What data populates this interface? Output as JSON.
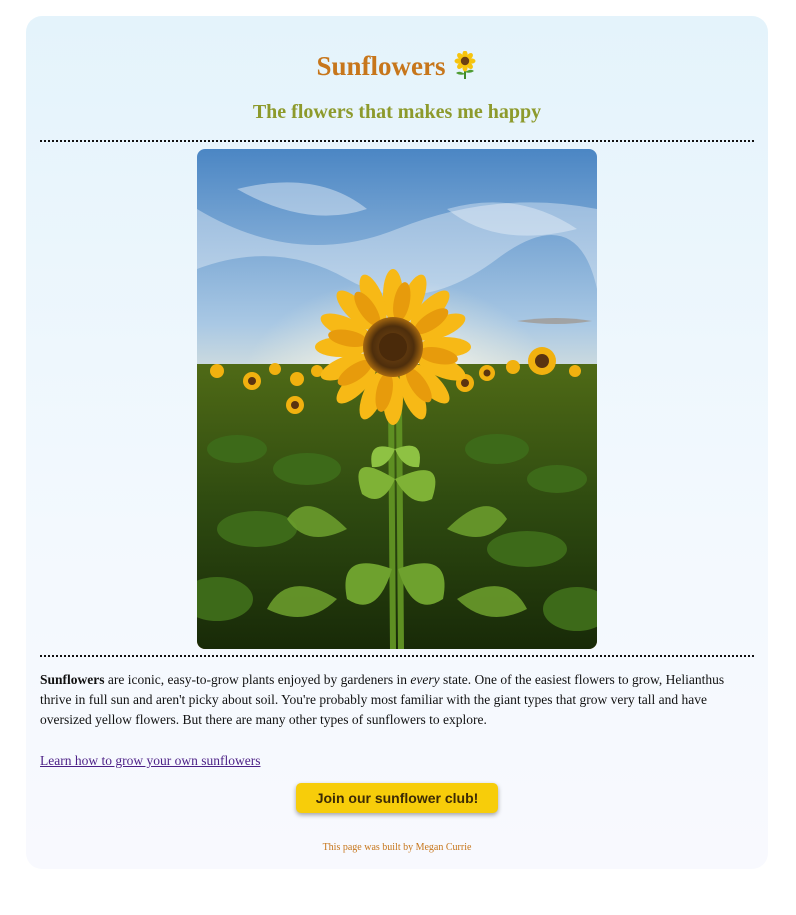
{
  "header": {
    "title": "Sunflowers",
    "title_icon": "sunflower-icon",
    "subtitle": "The flowers that makes me happy"
  },
  "image": {
    "subject": "sunflower-field-photo"
  },
  "content": {
    "lead_bold": "Sunflowers",
    "text_part1": " are iconic, easy-to-grow plants enjoyed by gardeners in ",
    "emphasis": "every",
    "text_part2": " state. One of the easiest flowers to grow, Helianthus thrive in full sun and aren't picky about soil. You're probably most familiar with the giant types that grow very tall and have oversized yellow flowers. But there are many other types of sunflowers to explore."
  },
  "link": {
    "label": "Learn how to grow your own sunflowers"
  },
  "cta": {
    "label": "Join our sunflower club!"
  },
  "footer": {
    "text": "This page was built by Megan Currie"
  },
  "colors": {
    "title": "#c7761b",
    "subtitle": "#8d9a2c",
    "button": "#f7cd0a",
    "link": "#4b1f86"
  }
}
